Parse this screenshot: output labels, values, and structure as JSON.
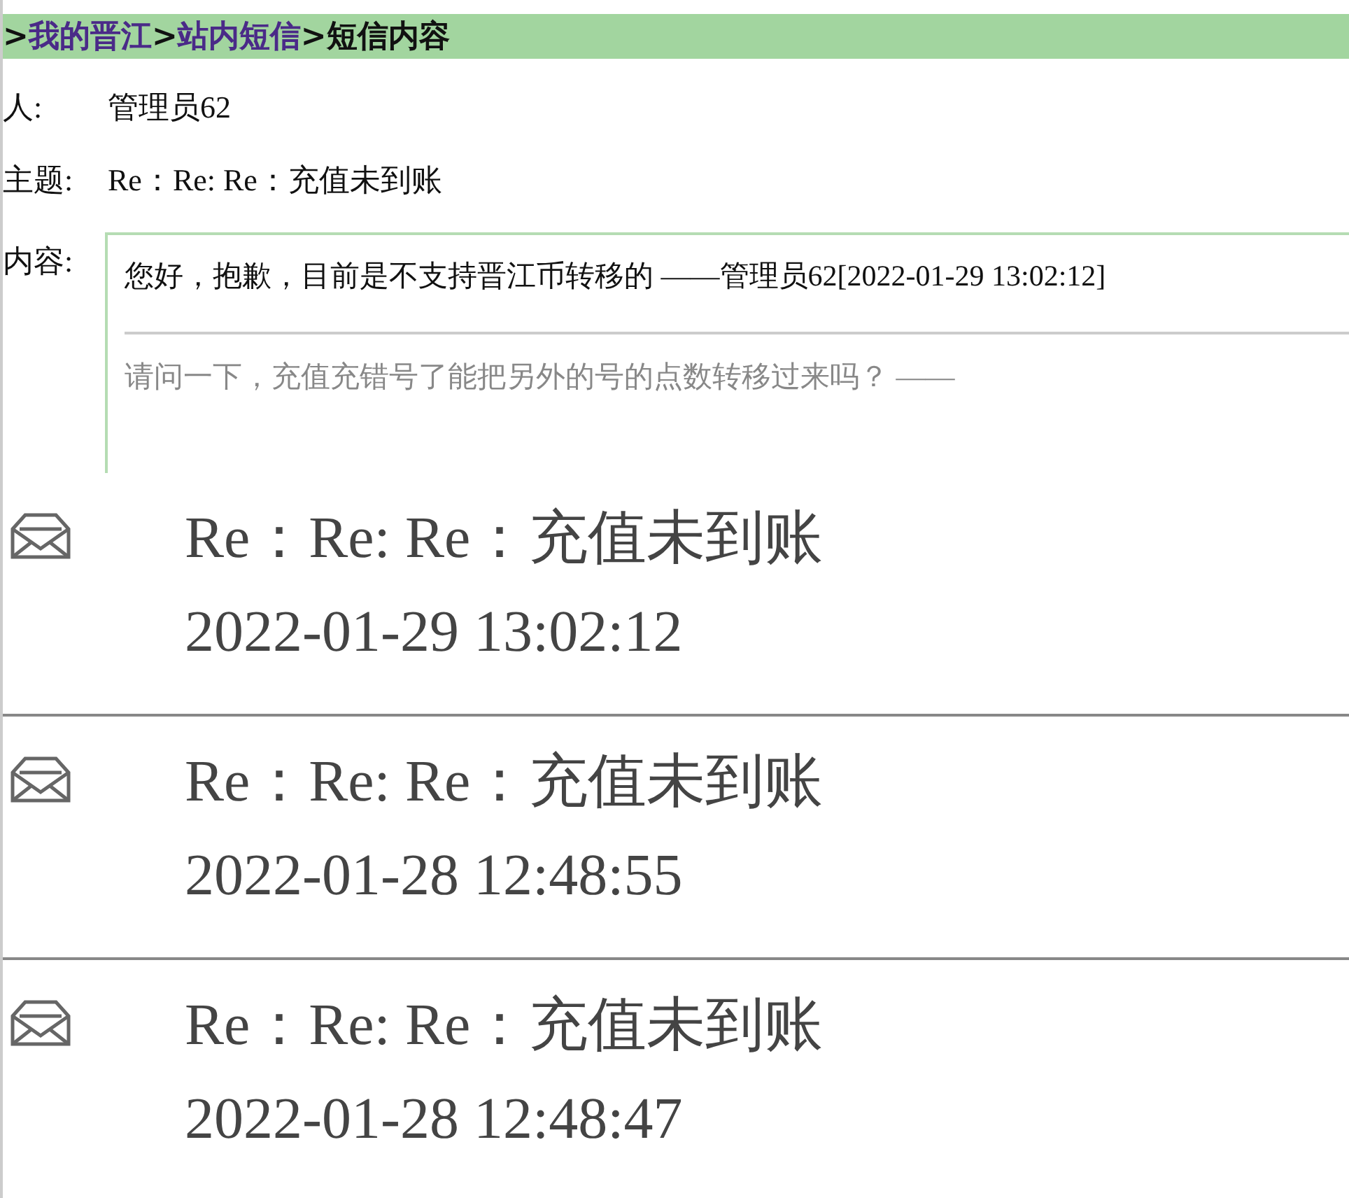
{
  "breadcrumb": [
    {
      "text": ">",
      "kind": "separator"
    },
    {
      "text": "我的晋江",
      "kind": "link"
    },
    {
      "text": ">",
      "kind": "separator"
    },
    {
      "text": "站内短信",
      "kind": "link"
    },
    {
      "text": ">",
      "kind": "separator"
    },
    {
      "text": "短信内容",
      "kind": "current"
    }
  ],
  "sender": {
    "label": "人:",
    "value": "管理员62"
  },
  "subject": {
    "label": "主题:",
    "value": "Re：Re: Re：充值未到账"
  },
  "content": {
    "label": "内容:",
    "reply": "您好，抱歉，目前是不支持晋江币转移的 ——管理员62[2022-01-29 13:02:12]",
    "quote": "请问一下，充值充错号了能把另外的号的点数转移过来吗？ ——"
  },
  "messages": [
    {
      "subject": "Re：Re: Re：充值未到账",
      "time": "2022-01-29 13:02:12"
    },
    {
      "subject": "Re：Re: Re：充值未到账",
      "time": "2022-01-28 12:48:55"
    },
    {
      "subject": "Re：Re: Re：充值未到账",
      "time": "2022-01-28 12:48:47"
    }
  ]
}
